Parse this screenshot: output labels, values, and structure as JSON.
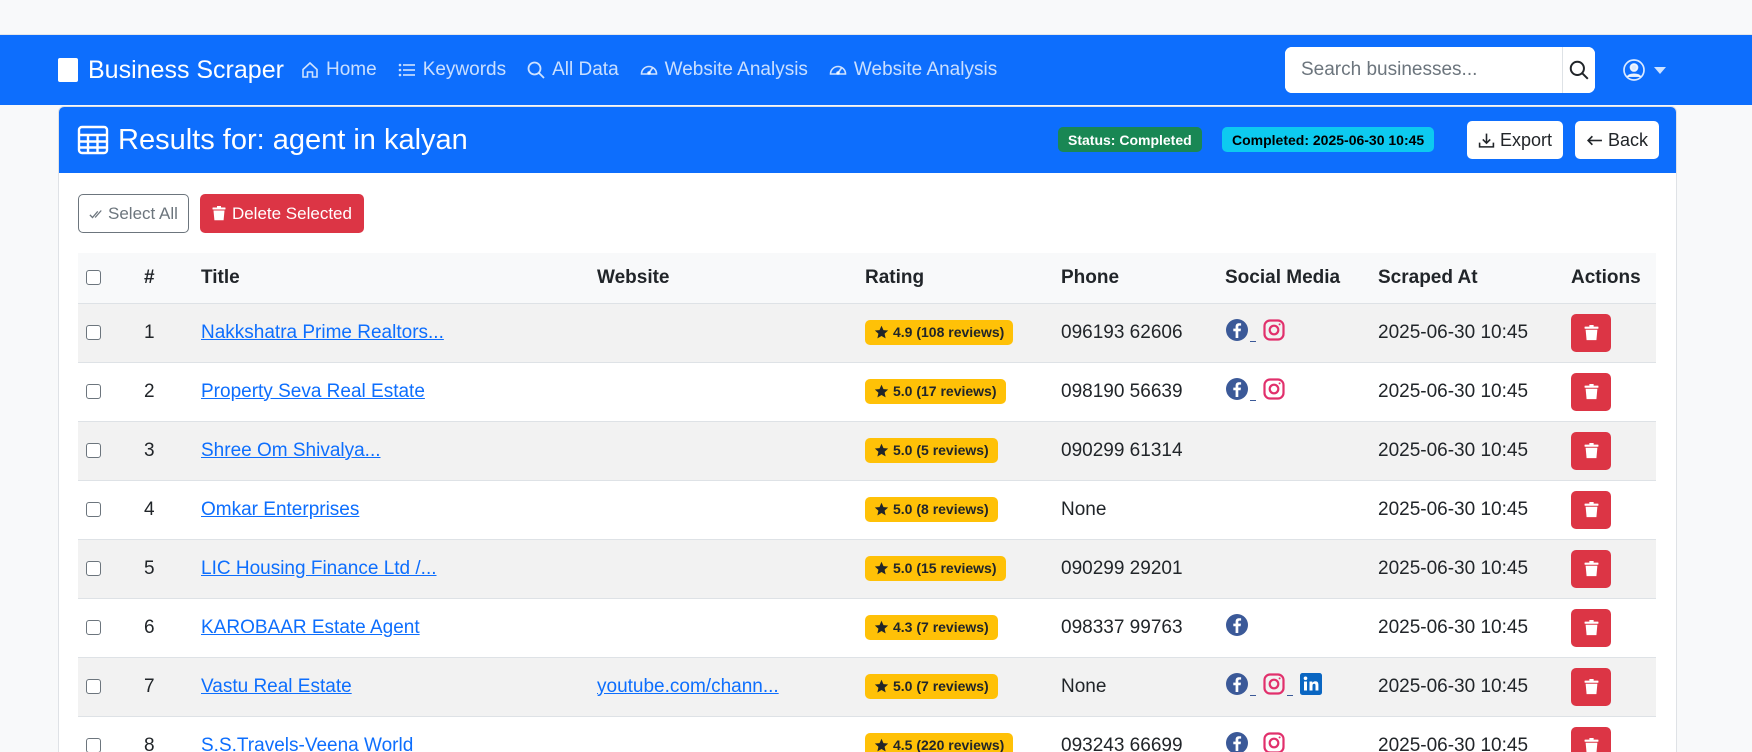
{
  "navbar": {
    "brand": "Business Scraper",
    "links": [
      {
        "label": "Home",
        "icon": "house-icon"
      },
      {
        "label": "Keywords",
        "icon": "list-icon"
      },
      {
        "label": "All Data",
        "icon": "search-icon"
      },
      {
        "label": "Website Analysis",
        "icon": "speedometer-icon"
      },
      {
        "label": "Website Analysis",
        "icon": "speedometer-icon"
      }
    ],
    "search_placeholder": "Search businesses...",
    "user_icon": "user-circle-icon"
  },
  "header": {
    "title": "Results for: agent in kalyan",
    "status_badge": "Status: Completed",
    "completed_badge": "Completed: 2025-06-30 10:45",
    "export_label": "Export",
    "back_label": "Back"
  },
  "toolbar": {
    "select_all": "Select All",
    "delete_selected": "Delete Selected"
  },
  "table": {
    "columns": [
      "#",
      "Title",
      "Website",
      "Rating",
      "Phone",
      "Social Media",
      "Scraped At",
      "Actions"
    ],
    "rows": [
      {
        "num": "1",
        "title": "Nakkshatra Prime Realtors...",
        "website": "",
        "rating": "4.9 (108 reviews)",
        "phone": "096193 62606",
        "social": [
          "facebook",
          "instagram"
        ],
        "scraped": "2025-06-30 10:45"
      },
      {
        "num": "2",
        "title": "Property Seva Real Estate",
        "website": "",
        "rating": "5.0 (17 reviews)",
        "phone": "098190 56639",
        "social": [
          "facebook",
          "instagram"
        ],
        "scraped": "2025-06-30 10:45"
      },
      {
        "num": "3",
        "title": "Shree Om Shivalya...",
        "website": "",
        "rating": "5.0 (5 reviews)",
        "phone": "090299 61314",
        "social": [],
        "scraped": "2025-06-30 10:45"
      },
      {
        "num": "4",
        "title": "Omkar Enterprises",
        "website": "",
        "rating": "5.0 (8 reviews)",
        "phone": "None",
        "social": [],
        "scraped": "2025-06-30 10:45"
      },
      {
        "num": "5",
        "title": "LIC Housing Finance Ltd /...",
        "website": "",
        "rating": "5.0 (15 reviews)",
        "phone": "090299 29201",
        "social": [],
        "scraped": "2025-06-30 10:45"
      },
      {
        "num": "6",
        "title": "KAROBAAR Estate Agent",
        "website": "",
        "rating": "4.3 (7 reviews)",
        "phone": "098337 99763",
        "social": [
          "facebook"
        ],
        "scraped": "2025-06-30 10:45"
      },
      {
        "num": "7",
        "title": "Vastu Real Estate",
        "website": "youtube.com/chann...",
        "rating": "5.0 (7 reviews)",
        "phone": "None",
        "social": [
          "facebook",
          "instagram",
          "linkedin"
        ],
        "scraped": "2025-06-30 10:45"
      },
      {
        "num": "8",
        "title": "S.S.Travels-Veena World",
        "website": "",
        "rating": "4.5 (220 reviews)",
        "phone": "093243 66699",
        "social": [
          "facebook",
          "instagram"
        ],
        "scraped": "2025-06-30 10:45"
      }
    ]
  },
  "colors": {
    "primary": "#0d6efd",
    "success": "#198754",
    "info": "#0dcaf0",
    "danger": "#dc3545",
    "warning": "#ffc107",
    "facebook": "#3b5998",
    "instagram": "#e1306c",
    "linkedin": "#0a66c2"
  }
}
